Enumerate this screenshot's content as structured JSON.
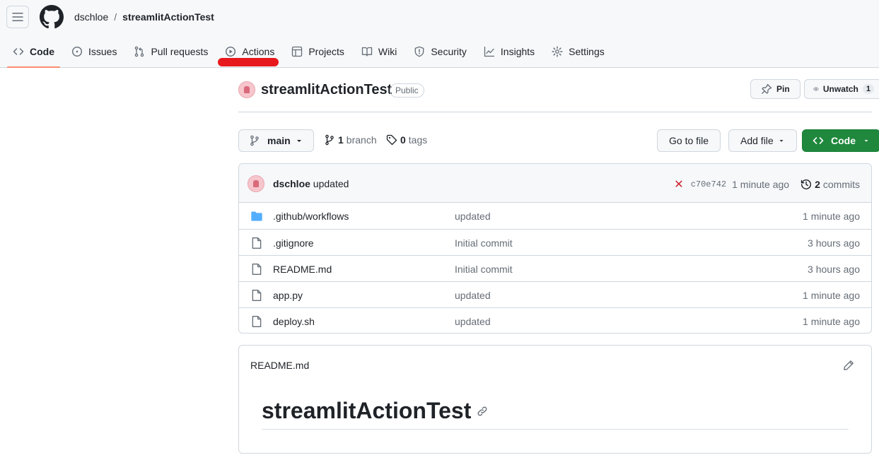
{
  "header": {
    "owner": "dschloe",
    "separator": "/",
    "repo": "streamlitActionTest"
  },
  "tabs": [
    {
      "label": "Code",
      "icon": "code-icon",
      "active": true
    },
    {
      "label": "Issues",
      "icon": "issue-icon"
    },
    {
      "label": "Pull requests",
      "icon": "pull-request-icon"
    },
    {
      "label": "Actions",
      "icon": "play-icon"
    },
    {
      "label": "Projects",
      "icon": "table-icon"
    },
    {
      "label": "Wiki",
      "icon": "book-icon"
    },
    {
      "label": "Security",
      "icon": "shield-icon"
    },
    {
      "label": "Insights",
      "icon": "graph-icon"
    },
    {
      "label": "Settings",
      "icon": "gear-icon"
    }
  ],
  "repo_head": {
    "name": "streamlitActionTest",
    "visibility": "Public",
    "pin_label": "Pin",
    "watch_label": "Unwatch",
    "watch_count": "1"
  },
  "branch_bar": {
    "branch": "main",
    "branch_count": "1",
    "branch_word": "branch",
    "tag_count": "0",
    "tag_word": "tags",
    "go_to_file": "Go to file",
    "add_file": "Add file",
    "code": "Code"
  },
  "latest_commit": {
    "author": "dschloe",
    "message": "updated",
    "sha": "c70e742",
    "time": "1 minute ago",
    "commit_count": "2",
    "commit_word": "commits",
    "status_color": "#cf222e"
  },
  "files": [
    {
      "name": ".github/workflows",
      "type": "folder",
      "message": "updated",
      "time": "1 minute ago"
    },
    {
      "name": ".gitignore",
      "type": "file",
      "message": "Initial commit",
      "time": "3 hours ago"
    },
    {
      "name": "README.md",
      "type": "file",
      "message": "Initial commit",
      "time": "3 hours ago"
    },
    {
      "name": "app.py",
      "type": "file",
      "message": "updated",
      "time": "1 minute ago"
    },
    {
      "name": "deploy.sh",
      "type": "file",
      "message": "updated",
      "time": "1 minute ago"
    }
  ],
  "readme": {
    "filename": "README.md",
    "heading": "streamlitActionTest"
  },
  "colors": {
    "accent_green": "#1f883d",
    "active_tab_underline": "#fd8c73",
    "annotation_red": "#e8191d",
    "folder_blue": "#54aeff"
  }
}
